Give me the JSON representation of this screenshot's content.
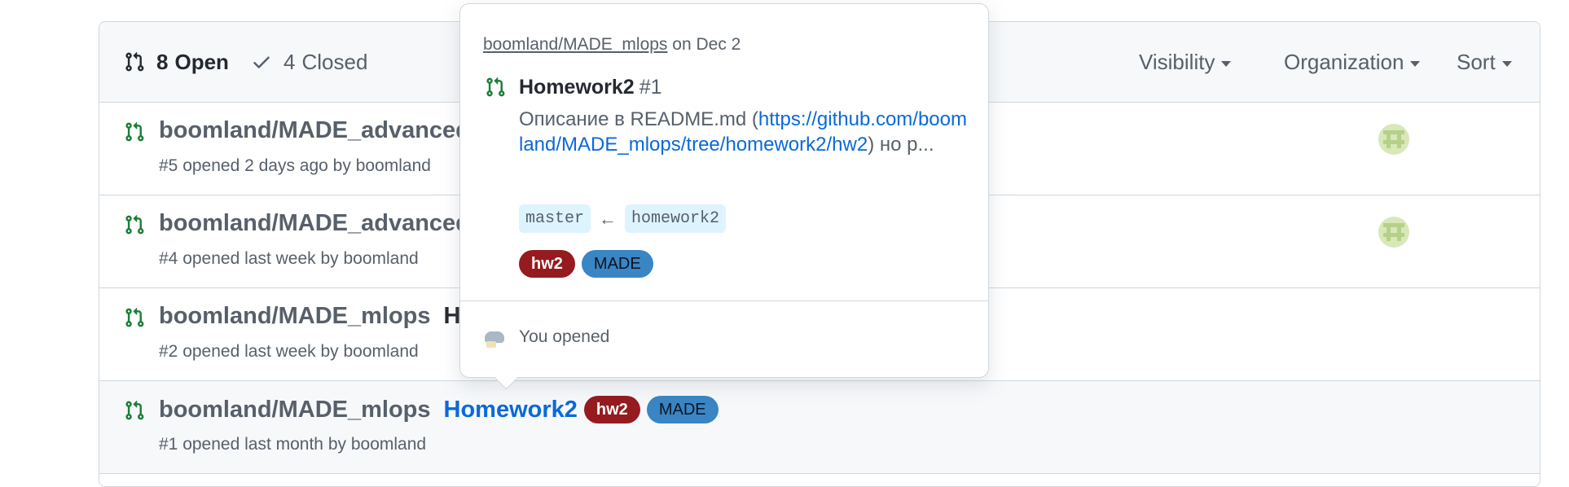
{
  "header": {
    "open_count": "8",
    "open_label": "Open",
    "closed_count": "4",
    "closed_label": "Closed",
    "filters": [
      "Visibility",
      "Organization",
      "Sort"
    ]
  },
  "rows": [
    {
      "repo": "boomland/MADE_advanced",
      "title": "",
      "meta": "#5 opened 2 days ago by boomland"
    },
    {
      "repo": "boomland/MADE_advanced",
      "title": "",
      "meta": "#4 opened last week by boomland"
    },
    {
      "repo": "boomland/MADE_mlops",
      "title": "H",
      "meta": "#2 opened last week by boomland"
    },
    {
      "repo": "boomland/MADE_mlops",
      "title": "Homework2",
      "meta": "#1 opened last month by boomland",
      "labels": [
        "hw2",
        "MADE"
      ]
    }
  ],
  "popover": {
    "repo": "boomland/MADE_mlops",
    "date": "on Dec 2",
    "title": "Homework2",
    "number": "#1",
    "body_prefix": "Описание в README.md (",
    "body_url": "https://github.com/boomland/MADE_mlops/tree/homework2/hw2",
    "body_suffix": ") но р...",
    "base_branch": "master",
    "arrow": "←",
    "head_branch": "homework2",
    "labels": [
      "hw2",
      "MADE"
    ],
    "footer": "You opened"
  },
  "colors": {
    "open_icon": "#1a7f37",
    "link": "#0969da",
    "label_hw2": "#951b1f",
    "label_made": "#3a85c4"
  }
}
